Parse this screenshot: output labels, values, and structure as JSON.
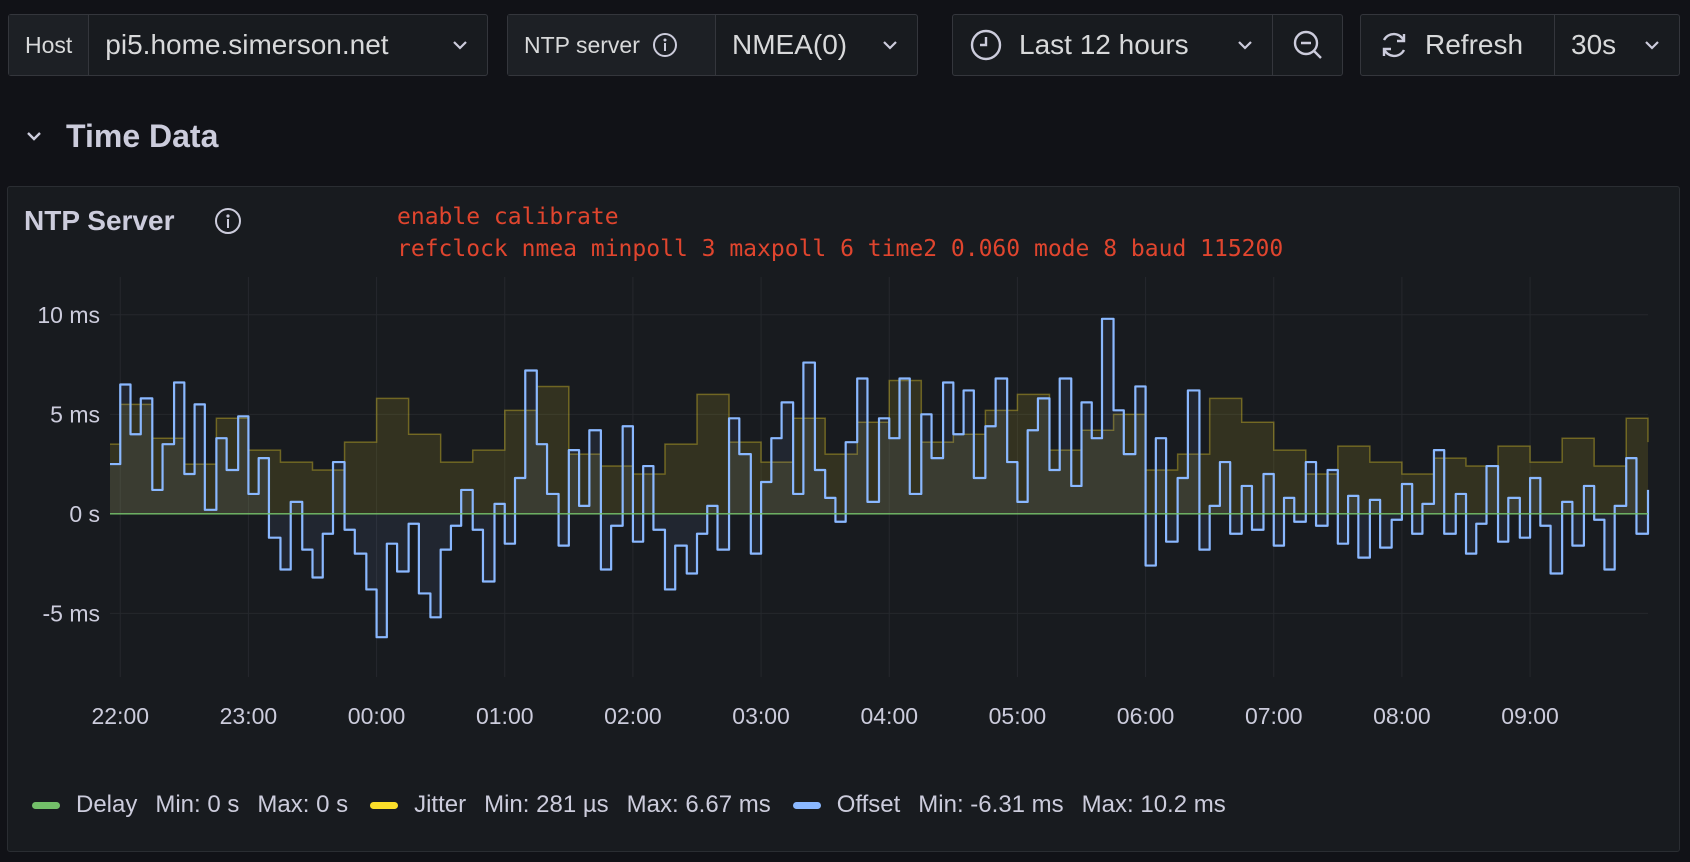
{
  "toolbar": {
    "host": {
      "label": "Host",
      "value": "pi5.home.simerson.net"
    },
    "ntp": {
      "label": "NTP server",
      "value": "NMEA(0)"
    },
    "time_range": {
      "value": "Last 12 hours"
    },
    "refresh": {
      "label": "Refresh",
      "interval": "30s"
    }
  },
  "row": {
    "title": "Time Data"
  },
  "panel": {
    "title": "NTP Server",
    "description_lines": [
      "enable calibrate",
      "refclock nmea minpoll 3 maxpoll 6 time2 0.060 mode 8 baud 115200"
    ]
  },
  "legend": [
    {
      "name": "Delay",
      "min": "Min: 0 s",
      "max": "Max: 0 s",
      "color": "#73bf69"
    },
    {
      "name": "Jitter",
      "min": "Min: 281 µs",
      "max": "Max: 6.67 ms",
      "color": "#fade2a"
    },
    {
      "name": "Offset",
      "min": "Min: -6.31 ms",
      "max": "Max: 10.2 ms",
      "color": "#8ab8ff"
    }
  ],
  "colors": {
    "background": "#111217",
    "panel": "#181b1f",
    "annotation": "#e0452e",
    "grid": "#25282d"
  },
  "chart_data": {
    "type": "line",
    "y_unit": "ms",
    "y_tick_values": [
      -5,
      0,
      5,
      10
    ],
    "y_tick_labels": [
      "-5 ms",
      "0 s",
      "5 ms",
      "10 ms"
    ],
    "ylim": [
      -8.2,
      11.9
    ],
    "x_tick_labels": [
      "22:00",
      "23:00",
      "00:00",
      "01:00",
      "02:00",
      "03:00",
      "04:00",
      "05:00",
      "06:00",
      "07:00",
      "08:00",
      "09:00"
    ],
    "x_tick_hours": [
      0,
      1,
      2,
      3,
      4,
      5,
      6,
      7,
      8,
      9,
      10,
      11
    ],
    "x_range_hours": [
      -0.08,
      11.92
    ],
    "grid": true,
    "legend_placement": "bottom-left",
    "series": [
      {
        "name": "Delay",
        "color": "#73bf69",
        "x_hours": [
          -0.08,
          11.92
        ],
        "values_ms": [
          0,
          0
        ]
      },
      {
        "name": "Jitter",
        "color": "#fade2a",
        "style": "filled-stepped",
        "x_hours": [
          -0.08,
          0.0,
          0.25,
          0.5,
          0.75,
          1.0,
          1.25,
          1.5,
          1.75,
          2.0,
          2.25,
          2.5,
          2.75,
          3.0,
          3.25,
          3.5,
          3.75,
          4.0,
          4.25,
          4.5,
          4.75,
          5.0,
          5.25,
          5.5,
          5.75,
          6.0,
          6.25,
          6.5,
          6.75,
          7.0,
          7.25,
          7.5,
          7.75,
          8.0,
          8.25,
          8.5,
          8.75,
          9.0,
          9.25,
          9.5,
          9.75,
          10.0,
          10.25,
          10.5,
          10.75,
          11.0,
          11.25,
          11.5,
          11.75,
          11.92
        ],
        "values_ms": [
          3.5,
          5.5,
          3.8,
          2.5,
          4.8,
          3.2,
          2.6,
          2.2,
          3.6,
          5.8,
          4.0,
          2.6,
          3.2,
          5.2,
          6.4,
          3.0,
          2.4,
          2.0,
          3.5,
          6.0,
          3.6,
          2.6,
          4.8,
          3.0,
          4.6,
          6.7,
          3.6,
          4.0,
          5.2,
          6.0,
          3.2,
          4.2,
          5.0,
          2.2,
          3.0,
          5.8,
          4.6,
          3.2,
          2.0,
          3.4,
          2.6,
          2.0,
          2.8,
          2.4,
          3.4,
          2.6,
          3.8,
          2.4,
          4.8,
          3.6
        ]
      },
      {
        "name": "Offset",
        "color": "#8ab8ff",
        "style": "stepped",
        "x_hours": [
          -0.08,
          0.0,
          0.08,
          0.16,
          0.25,
          0.33,
          0.42,
          0.5,
          0.58,
          0.66,
          0.75,
          0.83,
          0.92,
          1.0,
          1.08,
          1.16,
          1.25,
          1.33,
          1.42,
          1.5,
          1.58,
          1.66,
          1.75,
          1.83,
          1.92,
          2.0,
          2.08,
          2.16,
          2.25,
          2.33,
          2.42,
          2.5,
          2.58,
          2.66,
          2.75,
          2.83,
          2.92,
          3.0,
          3.08,
          3.16,
          3.25,
          3.33,
          3.42,
          3.5,
          3.58,
          3.66,
          3.75,
          3.83,
          3.92,
          4.0,
          4.08,
          4.16,
          4.25,
          4.33,
          4.42,
          4.5,
          4.58,
          4.66,
          4.75,
          4.83,
          4.92,
          5.0,
          5.08,
          5.16,
          5.25,
          5.33,
          5.42,
          5.5,
          5.58,
          5.66,
          5.75,
          5.83,
          5.92,
          6.0,
          6.08,
          6.16,
          6.25,
          6.33,
          6.42,
          6.5,
          6.58,
          6.66,
          6.75,
          6.83,
          6.92,
          7.0,
          7.08,
          7.16,
          7.25,
          7.33,
          7.42,
          7.5,
          7.58,
          7.66,
          7.75,
          7.83,
          7.92,
          8.0,
          8.08,
          8.16,
          8.25,
          8.33,
          8.42,
          8.5,
          8.58,
          8.66,
          8.75,
          8.83,
          8.92,
          9.0,
          9.08,
          9.16,
          9.25,
          9.33,
          9.42,
          9.5,
          9.58,
          9.66,
          9.75,
          9.83,
          9.92,
          10.0,
          10.08,
          10.16,
          10.25,
          10.33,
          10.42,
          10.5,
          10.58,
          10.66,
          10.75,
          10.83,
          10.92,
          11.0,
          11.08,
          11.16,
          11.25,
          11.33,
          11.42,
          11.5,
          11.58,
          11.66,
          11.75,
          11.83,
          11.92
        ],
        "values_ms": [
          2.5,
          6.5,
          4.0,
          5.8,
          1.2,
          3.5,
          6.6,
          2.0,
          5.5,
          0.2,
          3.8,
          2.2,
          4.9,
          1.0,
          2.8,
          -1.2,
          -2.8,
          0.6,
          -1.8,
          -3.2,
          -1.0,
          2.6,
          -0.8,
          -2.0,
          -3.8,
          -6.2,
          -1.5,
          -2.9,
          -0.5,
          -4.0,
          -5.2,
          -1.8,
          -0.6,
          1.2,
          -0.8,
          -3.4,
          0.5,
          -1.5,
          1.8,
          7.2,
          3.5,
          1.0,
          -1.6,
          3.2,
          0.4,
          4.2,
          -2.8,
          -0.6,
          4.4,
          -1.4,
          2.4,
          -0.8,
          -3.8,
          -1.6,
          -3.0,
          -1.0,
          0.4,
          -1.8,
          4.8,
          3.0,
          -2.0,
          1.6,
          3.8,
          5.6,
          1.0,
          7.6,
          2.2,
          0.8,
          -0.4,
          3.6,
          6.8,
          0.6,
          4.8,
          3.8,
          6.8,
          1.0,
          5.0,
          2.8,
          6.6,
          4.0,
          6.2,
          1.8,
          4.4,
          6.8,
          2.6,
          0.6,
          4.2,
          5.8,
          2.2,
          6.8,
          1.4,
          5.6,
          3.8,
          9.8,
          5.2,
          3.0,
          6.4,
          -2.6,
          3.8,
          -1.4,
          1.8,
          6.2,
          -1.8,
          0.4,
          2.6,
          -1.0,
          1.4,
          -0.8,
          2.0,
          -1.6,
          0.8,
          -0.4,
          2.6,
          -0.6,
          2.2,
          -1.5,
          0.9,
          -2.2,
          0.7,
          -1.7,
          -0.3,
          1.5,
          -1.0,
          0.5,
          3.2,
          -1.0,
          1.0,
          -2.0,
          -0.5,
          2.4,
          -1.4,
          0.8,
          -1.2,
          1.8,
          -0.6,
          -3.0,
          0.6,
          -1.6,
          1.4,
          -0.3,
          -2.8,
          0.4,
          2.8,
          -1.0,
          1.2,
          -0.8
        ]
      }
    ]
  }
}
